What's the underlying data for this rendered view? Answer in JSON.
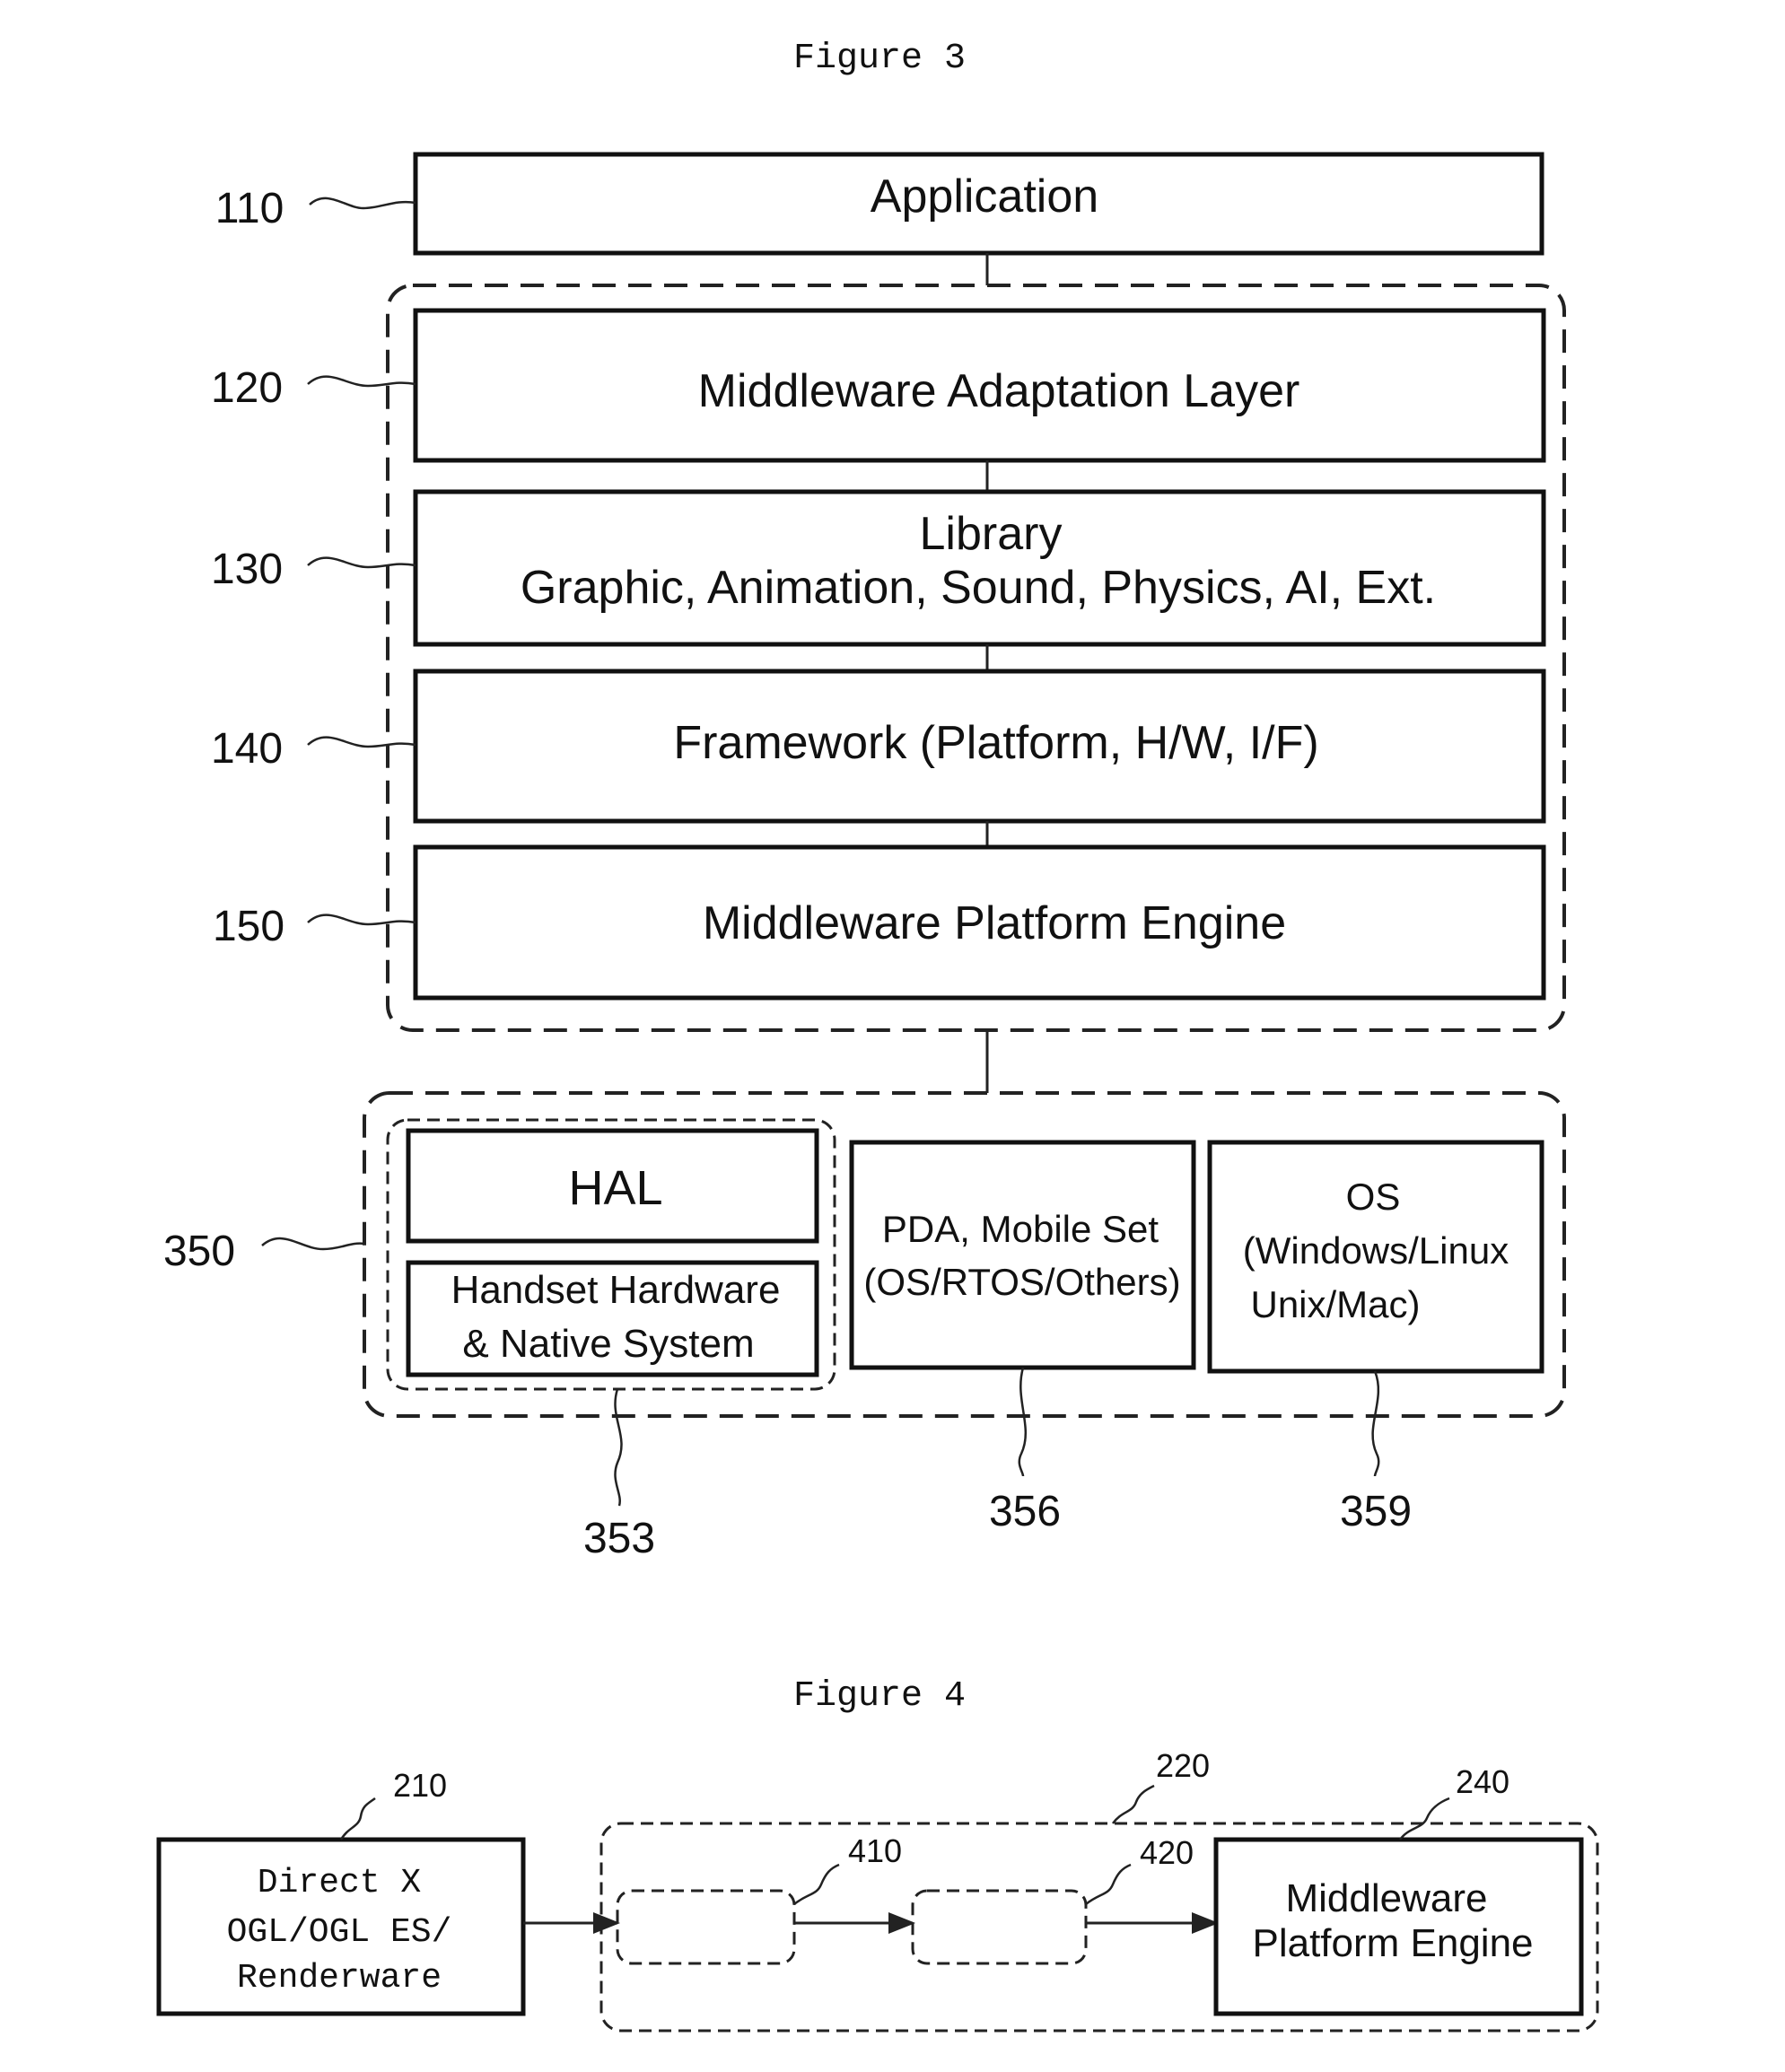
{
  "figure3": {
    "title": "Figure 3",
    "layers": [
      {
        "ref": "110",
        "label": "Application"
      },
      {
        "ref": "120",
        "label": "Middleware Adaptation Layer"
      },
      {
        "ref": "130",
        "label_line1": "Library",
        "label_line2": "Graphic, Animation, Sound, Physics, AI, Ext."
      },
      {
        "ref": "140",
        "label": "Framework (Platform, H/W, I/F)"
      },
      {
        "ref": "150",
        "label": "Middleware Platform Engine"
      }
    ],
    "platform_group": {
      "ref": "350",
      "hal_group": {
        "ref": "353",
        "hal": "HAL",
        "handset_line1": "Handset Hardware",
        "handset_line2": "& Native System"
      },
      "pda": {
        "ref": "356",
        "line1": "PDA, Mobile Set",
        "line2": "(OS/RTOS/Others)"
      },
      "os": {
        "ref": "359",
        "line1": "OS",
        "line2": "(Windows/Linux",
        "line3": "Unix/Mac)"
      }
    }
  },
  "figure4": {
    "title": "Figure 4",
    "source": {
      "ref": "210",
      "line1": "Direct X",
      "line2": "OGL/OGL ES/",
      "line3": "Renderware"
    },
    "group": {
      "ref": "220"
    },
    "stage1": {
      "ref": "410"
    },
    "stage2": {
      "ref": "420"
    },
    "engine": {
      "ref": "240",
      "line1": "Middleware",
      "line2": "Platform Engine"
    }
  }
}
